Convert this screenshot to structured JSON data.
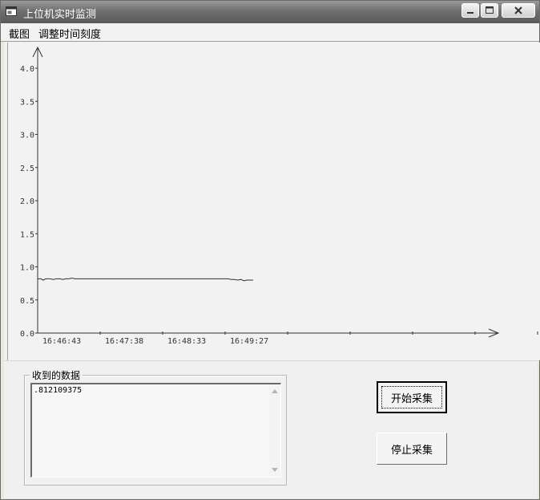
{
  "window": {
    "title": "上位机实时监测"
  },
  "menu": {
    "items": [
      "截图",
      "调整时间刻度"
    ]
  },
  "chart_data": {
    "type": "line",
    "y_ticks": [
      "0.0",
      "0.5",
      "1.0",
      "1.5",
      "2.0",
      "2.5",
      "3.0",
      "3.5",
      "4.0"
    ],
    "x_ticks": [
      "16:46:43",
      "16:47:38",
      "16:48:33",
      "16:49:27"
    ],
    "ylim": [
      0,
      4.3
    ],
    "series": [
      {
        "points": [
          [
            0,
            0.82
          ],
          [
            0.05,
            0.82
          ],
          [
            0.09,
            0.8
          ],
          [
            0.13,
            0.82
          ],
          [
            0.2,
            0.82
          ],
          [
            0.25,
            0.81
          ],
          [
            0.3,
            0.82
          ],
          [
            0.36,
            0.82
          ],
          [
            0.4,
            0.81
          ],
          [
            0.45,
            0.82
          ],
          [
            0.5,
            0.82
          ],
          [
            0.55,
            0.83
          ],
          [
            0.6,
            0.82
          ],
          [
            0.65,
            0.82
          ],
          [
            0.7,
            0.82
          ],
          [
            0.75,
            0.82
          ],
          [
            0.8,
            0.82
          ],
          [
            0.85,
            0.82
          ],
          [
            0.9,
            0.82
          ],
          [
            0.95,
            0.82
          ],
          [
            1.0,
            0.82
          ],
          [
            1.05,
            0.82
          ],
          [
            1.1,
            0.82
          ],
          [
            1.15,
            0.82
          ],
          [
            1.2,
            0.82
          ],
          [
            1.25,
            0.82
          ],
          [
            1.3,
            0.82
          ],
          [
            1.35,
            0.82
          ],
          [
            1.4,
            0.82
          ],
          [
            1.45,
            0.82
          ],
          [
            1.5,
            0.82
          ],
          [
            1.55,
            0.82
          ],
          [
            1.6,
            0.82
          ],
          [
            1.65,
            0.82
          ],
          [
            1.7,
            0.82
          ],
          [
            1.75,
            0.82
          ],
          [
            1.8,
            0.82
          ],
          [
            1.85,
            0.82
          ],
          [
            1.9,
            0.82
          ],
          [
            1.95,
            0.82
          ],
          [
            2.0,
            0.82
          ],
          [
            2.05,
            0.82
          ],
          [
            2.1,
            0.82
          ],
          [
            2.15,
            0.82
          ],
          [
            2.2,
            0.82
          ],
          [
            2.25,
            0.82
          ],
          [
            2.3,
            0.82
          ],
          [
            2.35,
            0.82
          ],
          [
            2.4,
            0.82
          ],
          [
            2.45,
            0.82
          ],
          [
            2.5,
            0.82
          ],
          [
            2.55,
            0.82
          ],
          [
            2.6,
            0.82
          ],
          [
            2.65,
            0.82
          ],
          [
            2.7,
            0.82
          ],
          [
            2.75,
            0.82
          ],
          [
            2.8,
            0.82
          ],
          [
            2.85,
            0.82
          ],
          [
            2.9,
            0.82
          ],
          [
            2.95,
            0.82
          ],
          [
            3.0,
            0.82
          ],
          [
            3.05,
            0.82
          ],
          [
            3.1,
            0.81
          ],
          [
            3.15,
            0.81
          ],
          [
            3.2,
            0.8
          ],
          [
            3.25,
            0.81
          ],
          [
            3.3,
            0.79
          ],
          [
            3.35,
            0.8
          ],
          [
            3.4,
            0.8
          ],
          [
            3.45,
            0.8
          ]
        ]
      }
    ],
    "grid": false
  },
  "received": {
    "label": "收到的数据",
    "value": ".812109375"
  },
  "buttons": {
    "start": "开始采集",
    "stop": "停止采集"
  }
}
